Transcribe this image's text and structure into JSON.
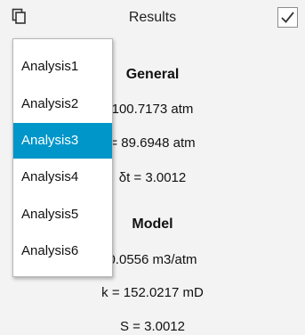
{
  "header": {
    "title": "Results",
    "toggle_icon": "copy-icon",
    "checkbox_icon": "checkmark-icon",
    "checkbox_checked": true
  },
  "results": {
    "general": {
      "title": "General",
      "lines": [
        "100.7173 atm",
        "= 89.6948 atm",
        "δt = 3.0012"
      ]
    },
    "model": {
      "title": "Model",
      "lines": [
        "0.0556 m3/atm",
        "k = 152.0217 mD",
        "S = 3.0012"
      ]
    }
  },
  "menu": {
    "selected_index": 2,
    "items": [
      "Analysis1",
      "Analysis2",
      "Analysis3",
      "Analysis4",
      "Analysis5",
      "Analysis6"
    ]
  },
  "colors": {
    "selected_bg": "#0096c9",
    "selected_text": "#ffffff",
    "panel_bg": "#f3f3f3"
  }
}
